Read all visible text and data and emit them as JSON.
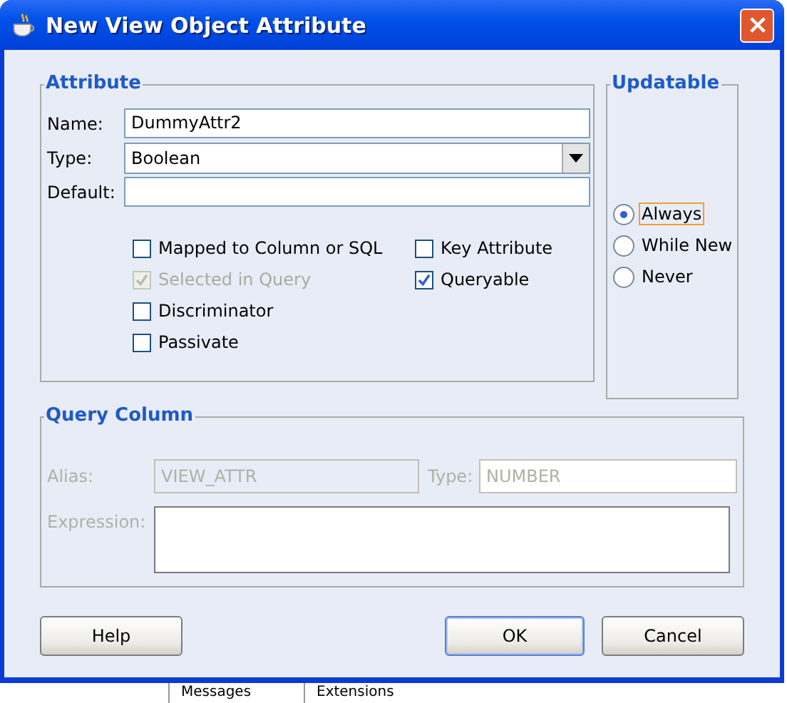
{
  "window": {
    "title": "New View Object Attribute"
  },
  "attribute": {
    "title": "Attribute",
    "fields": [
      {
        "label": "Name:",
        "kind": "text",
        "value": "DummyAttr2"
      },
      {
        "label": "Type:",
        "kind": "dropdown",
        "value": "Boolean"
      },
      {
        "label": "Default:",
        "kind": "text"
      }
    ],
    "options_left": [
      {
        "label": "Mapped to Column or SQL",
        "checked": false,
        "disabled": false
      },
      {
        "label": "Selected in Query",
        "checked": true,
        "disabled": true
      },
      {
        "label": "Discriminator",
        "checked": false,
        "disabled": false
      },
      {
        "label": "Passivate",
        "checked": false,
        "disabled": false
      }
    ],
    "options_right": [
      {
        "label": "Key Attribute",
        "checked": false,
        "disabled": false
      },
      {
        "label": "Queryable",
        "checked": true,
        "disabled": false
      }
    ]
  },
  "updatable": {
    "title": "Updatable",
    "options": [
      {
        "label": "Always",
        "selected": true
      },
      {
        "label": "While New",
        "selected": false
      },
      {
        "label": "Never",
        "selected": false
      }
    ]
  },
  "query_column": {
    "title": "Query Column",
    "disabled": true,
    "alias": {
      "label": "Alias:",
      "value": "VIEW_ATTR"
    },
    "type": {
      "label": "Type:",
      "value": "NUMBER"
    },
    "expression": {
      "label": "Expression:"
    }
  },
  "buttons": [
    {
      "label": "Help",
      "default": false
    },
    {
      "label": "OK",
      "default": true
    },
    {
      "label": "Cancel",
      "default": false
    }
  ],
  "background_tabs": [
    "Messages",
    "Extensions"
  ]
}
